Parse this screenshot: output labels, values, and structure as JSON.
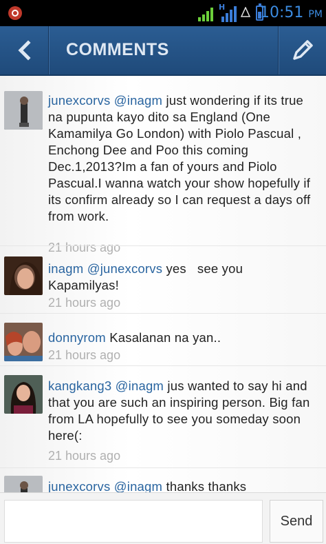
{
  "status_bar": {
    "time": "10:51",
    "ampm": "PM",
    "network_badge": "H"
  },
  "header": {
    "title": "COMMENTS"
  },
  "comments": [
    {
      "user": "junexcorvs",
      "mention": "@inagm",
      "text": "just wondering if its true na pupunta kayo dito sa England (One Kamamilya Go London) with Piolo Pascual , Enchong Dee and Poo this coming Dec.1,2013?Im a fan of yours and Piolo Pascual.I wanna watch your show hopefully if its confirm already so I can request a days off from work.",
      "time": "21 hours ago"
    },
    {
      "user": "inagm",
      "mention": "@junexcorvs",
      "text": "yes   see you Kapamilyas!",
      "time": "21 hours ago"
    },
    {
      "user": "donnyrom",
      "mention": "",
      "text": "Kasalanan na yan..",
      "time": "21 hours ago"
    },
    {
      "user": "kangkang3",
      "mention": "@inagm",
      "text": "jus wanted to say hi and that you are such an inspiring person. Big fan from LA hopefully to see you someday soon here(:",
      "time": "21 hours ago"
    },
    {
      "user": "junexcorvs",
      "mention": "@inagm",
      "text": "thanks thanks",
      "time": ""
    }
  ],
  "composer": {
    "placeholder": "",
    "send_label": "Send"
  },
  "colors": {
    "appbar": "#2b5d93",
    "username": "#2a65a0",
    "timestamp": "#b0b0b0",
    "clock": "#3b8be0"
  }
}
